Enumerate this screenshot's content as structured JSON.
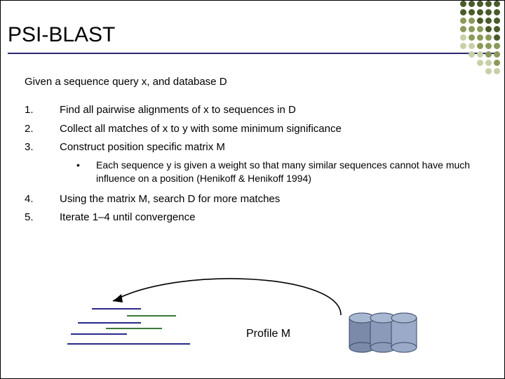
{
  "title": "PSI-BLAST",
  "intro": "Given a sequence query x, and database D",
  "steps": [
    {
      "n": "1.",
      "text": "Find all pairwise alignments of x to sequences in D"
    },
    {
      "n": "2.",
      "text": "Collect all matches of x to y with some minimum significance"
    },
    {
      "n": "3.",
      "text": "Construct position specific matrix M"
    }
  ],
  "sub_bullet": "•",
  "sub_text": "Each sequence y is given a weight so that many similar sequences cannot have much influence on a position (Henikoff & Henikoff 1994)",
  "steps2": [
    {
      "n": "4.",
      "text": "Using the matrix M, search D for more matches"
    },
    {
      "n": "5.",
      "text": "Iterate 1–4 until convergence"
    }
  ],
  "profile_label": "Profile M",
  "dot_colors": {
    "dark": "#4a5a2a",
    "mid": "#8a9a5a",
    "light": "#c8d0a8"
  }
}
